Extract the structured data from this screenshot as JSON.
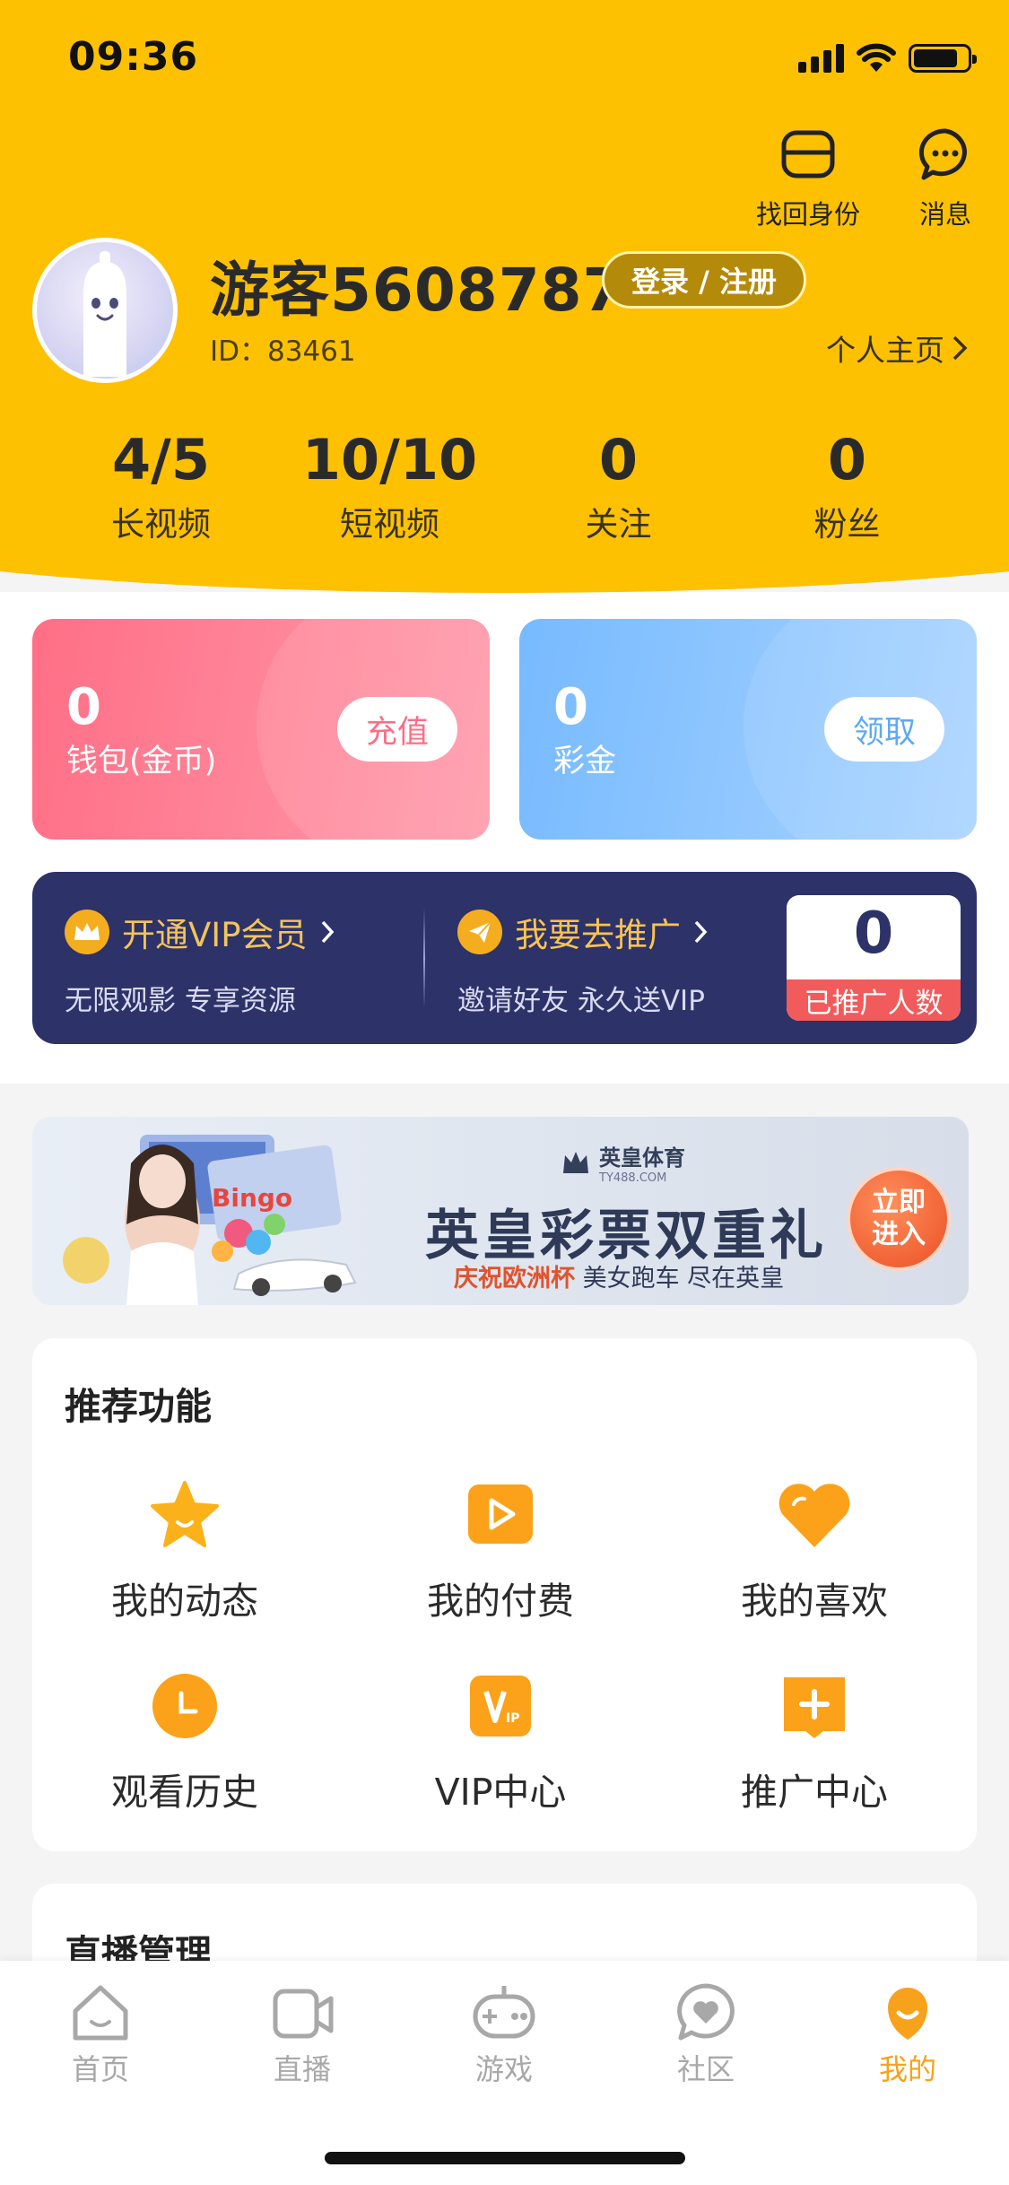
{
  "status_bar": {
    "time": "09:36"
  },
  "header": {
    "recover_label": "找回身份",
    "messages_label": "消息",
    "username": "游客5608787",
    "login_label": "登录 / 注册",
    "uid": "ID：83461",
    "home_link": "个人主页",
    "stats": [
      {
        "value": "4/5",
        "label": "长视频"
      },
      {
        "value": "10/10",
        "label": "短视频"
      },
      {
        "value": "0",
        "label": "关注"
      },
      {
        "value": "0",
        "label": "粉丝"
      }
    ]
  },
  "wallet": {
    "coins": {
      "value": "0",
      "label": "钱包(金币)",
      "button": "充值"
    },
    "bonus": {
      "value": "0",
      "label": "彩金",
      "button": "领取"
    }
  },
  "vip": {
    "vip_title": "开通VIP会员",
    "vip_sub": "无限观影 专享资源",
    "promo_title": "我要去推广",
    "promo_sub": "邀请好友 永久送VIP",
    "promo_count": "0",
    "promo_count_label": "已推广人数"
  },
  "banner": {
    "brand": "英皇体育",
    "brand_url": "TY488.COM",
    "title": "英皇彩票双重礼",
    "sub_red": "庆祝欧洲杯",
    "sub_dark": "美女跑车 尽在英皇",
    "button_line1": "立即",
    "button_line2": "进入",
    "art_text": "Bingo"
  },
  "recommended": {
    "title": "推荐功能",
    "items": [
      {
        "label": "我的动态",
        "icon": "star-icon"
      },
      {
        "label": "我的付费",
        "icon": "play-icon"
      },
      {
        "label": "我的喜欢",
        "icon": "heart-icon"
      },
      {
        "label": "观看历史",
        "icon": "clock-icon"
      },
      {
        "label": "VIP中心",
        "icon": "vip-icon"
      },
      {
        "label": "推广中心",
        "icon": "plus-icon"
      }
    ]
  },
  "live_manage": {
    "title": "直播管理"
  },
  "tabs": [
    {
      "label": "首页",
      "icon": "home-icon"
    },
    {
      "label": "直播",
      "icon": "camera-icon"
    },
    {
      "label": "游戏",
      "icon": "gamepad-icon"
    },
    {
      "label": "社区",
      "icon": "community-icon"
    },
    {
      "label": "我的",
      "icon": "profile-icon"
    }
  ],
  "colors": {
    "accent": "#fdc102",
    "tab_active": "#f7a21a",
    "vip_bg": "#2d3269"
  }
}
